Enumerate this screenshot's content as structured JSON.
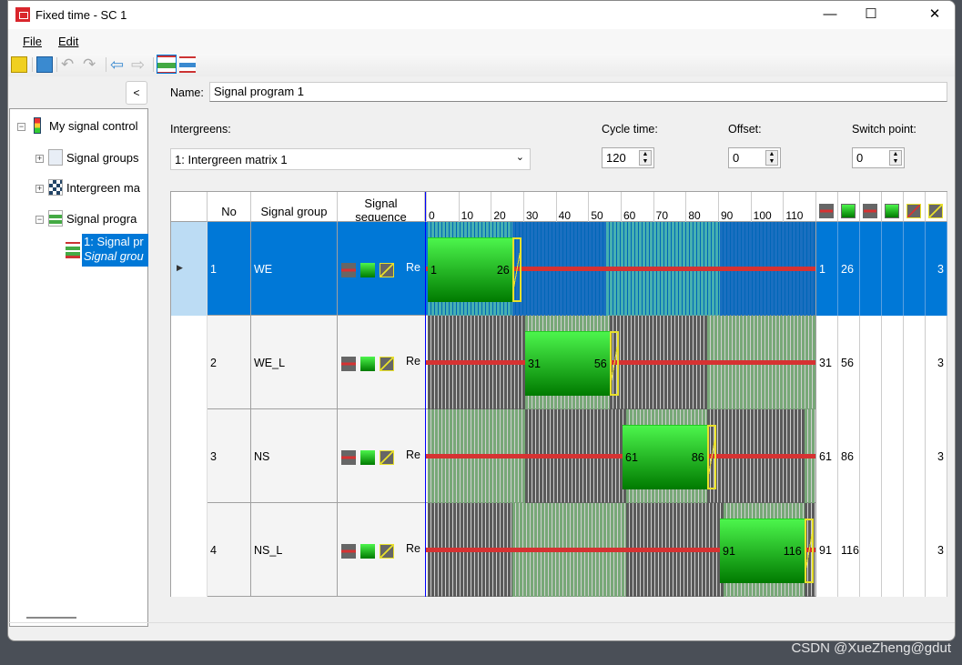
{
  "window": {
    "title": "Fixed time - SC 1",
    "minimize": "—",
    "maximize": "☐",
    "close": "✕"
  },
  "menu": [
    "File",
    "Edit"
  ],
  "toolbar": {
    "icons": [
      "import-icon",
      "save-icon",
      "undo-icon",
      "redo-icon",
      "back-arrow-icon",
      "forward-arrow-icon",
      "edit-green-times-icon",
      "adjust-interstage-icon"
    ]
  },
  "sidebar": {
    "collapse_label": "<",
    "tree": {
      "root": "My signal control",
      "children": [
        "Signal groups",
        "Intergreen ma",
        "Signal progra"
      ],
      "selected": {
        "line1": "1: Signal pr",
        "line2": "Signal grou"
      }
    }
  },
  "form": {
    "name_label": "Name:",
    "name_value": "Signal program 1",
    "intergreens_label": "Intergreens:",
    "intergreens_value": "1: Intergreen matrix 1",
    "cycle_label": "Cycle time:",
    "cycle_value": "120",
    "offset_label": "Offset:",
    "offset_value": "0",
    "switch_label": "Switch point:",
    "switch_value": "0"
  },
  "grid": {
    "headers": {
      "no": "No",
      "group": "Signal group",
      "sequence": "Signal sequence"
    },
    "ticks": [
      "0",
      "10",
      "20",
      "30",
      "40",
      "50",
      "60",
      "70",
      "80",
      "90",
      "100",
      "110"
    ],
    "cycle": 120,
    "extra_columns": [
      "red-end-icon",
      "green-end-icon",
      "red-end-icon",
      "green-end-icon",
      "red-crossed-icon",
      "amber-icon"
    ],
    "colors": {
      "green_top": "#4cf54c",
      "green_bottom": "#007a00",
      "amber": "#e8e02a",
      "red": "#d63232",
      "selected": "#0078d7"
    },
    "rows": [
      {
        "no": "1",
        "group": "WE",
        "seq": "Re",
        "start": "1",
        "end": "26",
        "green_start": 1,
        "green_end": 26,
        "amber": 3,
        "c1": "1",
        "c2": "26",
        "c6": "3",
        "selected": true,
        "regions": [
          [
            0,
            26,
            "g"
          ],
          [
            26,
            55,
            "d"
          ],
          [
            55,
            90,
            "g"
          ],
          [
            90,
            120,
            "d"
          ]
        ]
      },
      {
        "no": "2",
        "group": "WE_L",
        "seq": "Re",
        "start": "31",
        "end": "56",
        "green_start": 31,
        "green_end": 56,
        "amber": 3,
        "c1": "31",
        "c2": "56",
        "c6": "3",
        "regions": [
          [
            0,
            30,
            "d"
          ],
          [
            30,
            56,
            "g"
          ],
          [
            56,
            86,
            "d"
          ],
          [
            86,
            120,
            "g"
          ]
        ]
      },
      {
        "no": "3",
        "group": "NS",
        "seq": "Re",
        "start": "61",
        "end": "86",
        "green_start": 61,
        "green_end": 86,
        "amber": 3,
        "c1": "61",
        "c2": "86",
        "c6": "3",
        "regions": [
          [
            0,
            30,
            "g"
          ],
          [
            30,
            61,
            "d"
          ],
          [
            61,
            86,
            "g"
          ],
          [
            86,
            116,
            "d"
          ],
          [
            116,
            120,
            "g"
          ]
        ]
      },
      {
        "no": "4",
        "group": "NS_L",
        "seq": "Re",
        "start": "91",
        "end": "116",
        "green_start": 91,
        "green_end": 116,
        "amber": 3,
        "c1": "91",
        "c2": "116",
        "c6": "3",
        "regions": [
          [
            0,
            26,
            "d"
          ],
          [
            26,
            61,
            "g"
          ],
          [
            61,
            91,
            "d"
          ],
          [
            91,
            116,
            "g"
          ],
          [
            116,
            120,
            "d"
          ]
        ]
      }
    ]
  },
  "watermark": "CSDN @XueZheng@gdut"
}
